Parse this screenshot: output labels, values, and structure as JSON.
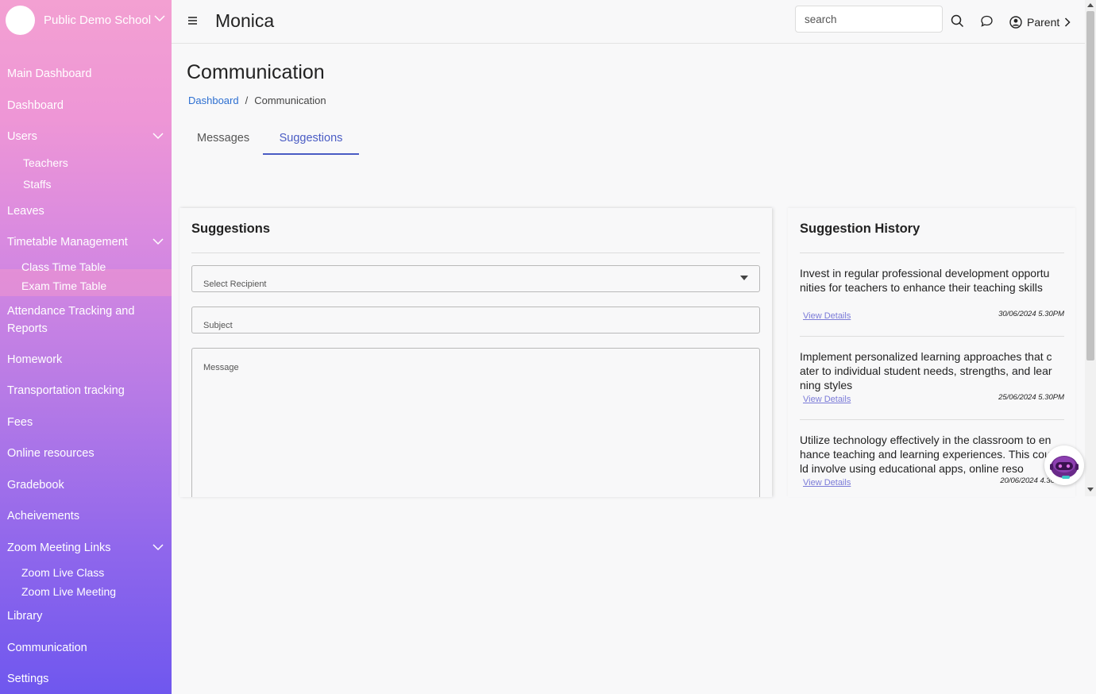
{
  "sidebar": {
    "school_name": "Public Demo School",
    "items": [
      {
        "label": "Main Dashboard"
      },
      {
        "label": "Dashboard"
      },
      {
        "label": "Users"
      },
      {
        "label": "Teachers"
      },
      {
        "label": "Staffs"
      },
      {
        "label": "Leaves"
      },
      {
        "label": "Timetable Management"
      },
      {
        "label": "Class Time Table"
      },
      {
        "label": "Exam Time Table"
      },
      {
        "label": "Attendance Tracking and Reports"
      },
      {
        "label": "Homework"
      },
      {
        "label": "Transportation tracking"
      },
      {
        "label": "Fees"
      },
      {
        "label": "Online resources"
      },
      {
        "label": "Gradebook"
      },
      {
        "label": "Acheivements"
      },
      {
        "label": "Zoom Meeting Links"
      },
      {
        "label": "Zoom Live Class"
      },
      {
        "label": "Zoom Live Meeting"
      },
      {
        "label": "Library"
      },
      {
        "label": "Communication"
      },
      {
        "label": "Settings"
      }
    ]
  },
  "header": {
    "title": "Monica",
    "search_placeholder": "search",
    "user_role": "Parent"
  },
  "page": {
    "title": "Communication",
    "breadcrumb": {
      "home": "Dashboard",
      "separator": "/",
      "current": "Communication"
    },
    "tabs": [
      {
        "label": "Messages"
      },
      {
        "label": "Suggestions"
      }
    ]
  },
  "suggestions_form": {
    "title": "Suggestions",
    "recipient_placeholder": "Select Recipient",
    "subject_placeholder": "Subject",
    "message_placeholder": "Message"
  },
  "history": {
    "title": "Suggestion History",
    "items": [
      {
        "text": "Invest in regular professional development opportunities for teachers to enhance their teaching skills",
        "link": "View Details",
        "date": "30/06/2024 5.30PM"
      },
      {
        "text": "Implement personalized learning approaches that cater to individual student needs, strengths, and learning styles",
        "link": "View Details",
        "date": "25/06/2024 5.30PM"
      },
      {
        "text": "Utilize technology effectively in the classroom to enhance teaching and learning experiences. This could involve using educational apps, online reso",
        "link": "View Details",
        "date": "20/06/2024 4.30"
      }
    ]
  },
  "colors": {
    "accent": "#4a5cc4",
    "link": "#2d6fd1",
    "sidebar_top": "#f3a0d2",
    "sidebar_bottom": "#6f57ee"
  }
}
